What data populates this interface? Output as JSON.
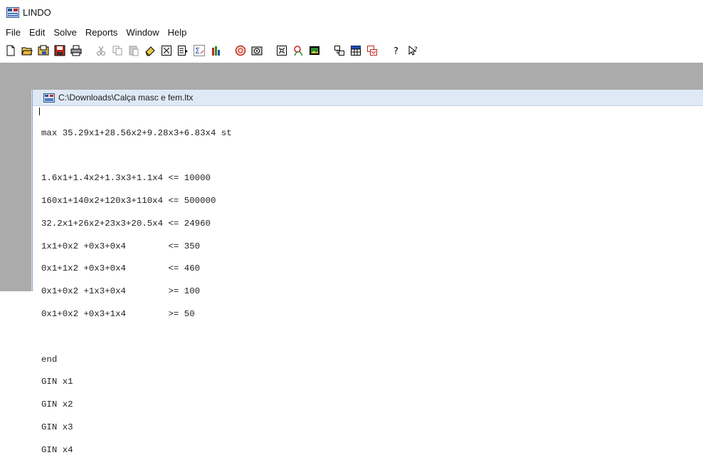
{
  "app": {
    "title": "LINDO"
  },
  "menu": {
    "items": [
      "File",
      "Edit",
      "Solve",
      "Reports",
      "Window",
      "Help"
    ]
  },
  "toolbar": {
    "groups": [
      [
        "new-file-icon",
        "open-folder-icon",
        "open-view-icon",
        "save-icon",
        "print-icon"
      ],
      [
        "cut-icon",
        "copy-icon",
        "paste-icon",
        "clear-icon",
        "clear-all-icon",
        "insert-icon",
        "sum-icon",
        "bar-chart-icon"
      ],
      [
        "solve-icon",
        "compile-icon"
      ],
      [
        "options-icon",
        "find-icon",
        "picture-icon"
      ],
      [
        "tile-icon",
        "grid-icon",
        "cascade-icon"
      ],
      [
        "help-icon",
        "context-help-icon"
      ]
    ]
  },
  "document": {
    "title": "C:\\Downloads\\Calça masc e fem.ltx",
    "lines": [
      "max 35.29x1+28.56x2+9.28x3+6.83x4 st",
      "",
      "1.6x1+1.4x2+1.3x3+1.1x4 <= 10000",
      "160x1+140x2+120x3+110x4 <= 500000",
      "32.2x1+26x2+23x3+20.5x4 <= 24960",
      "1x1+0x2 +0x3+0x4        <= 350",
      "0x1+1x2 +0x3+0x4        <= 460",
      "0x1+0x2 +1x3+0x4        >= 100",
      "0x1+0x2 +0x3+1x4        >= 50",
      "",
      "end",
      "GIN x1",
      "GIN x2",
      "GIN x3",
      "GIN x4"
    ]
  },
  "colors": {
    "mdi_background": "#ababab",
    "doc_titlebar": "#dfe9f5",
    "toolbar_red": "#c0261c",
    "toolbar_blue": "#1f4fb0"
  }
}
